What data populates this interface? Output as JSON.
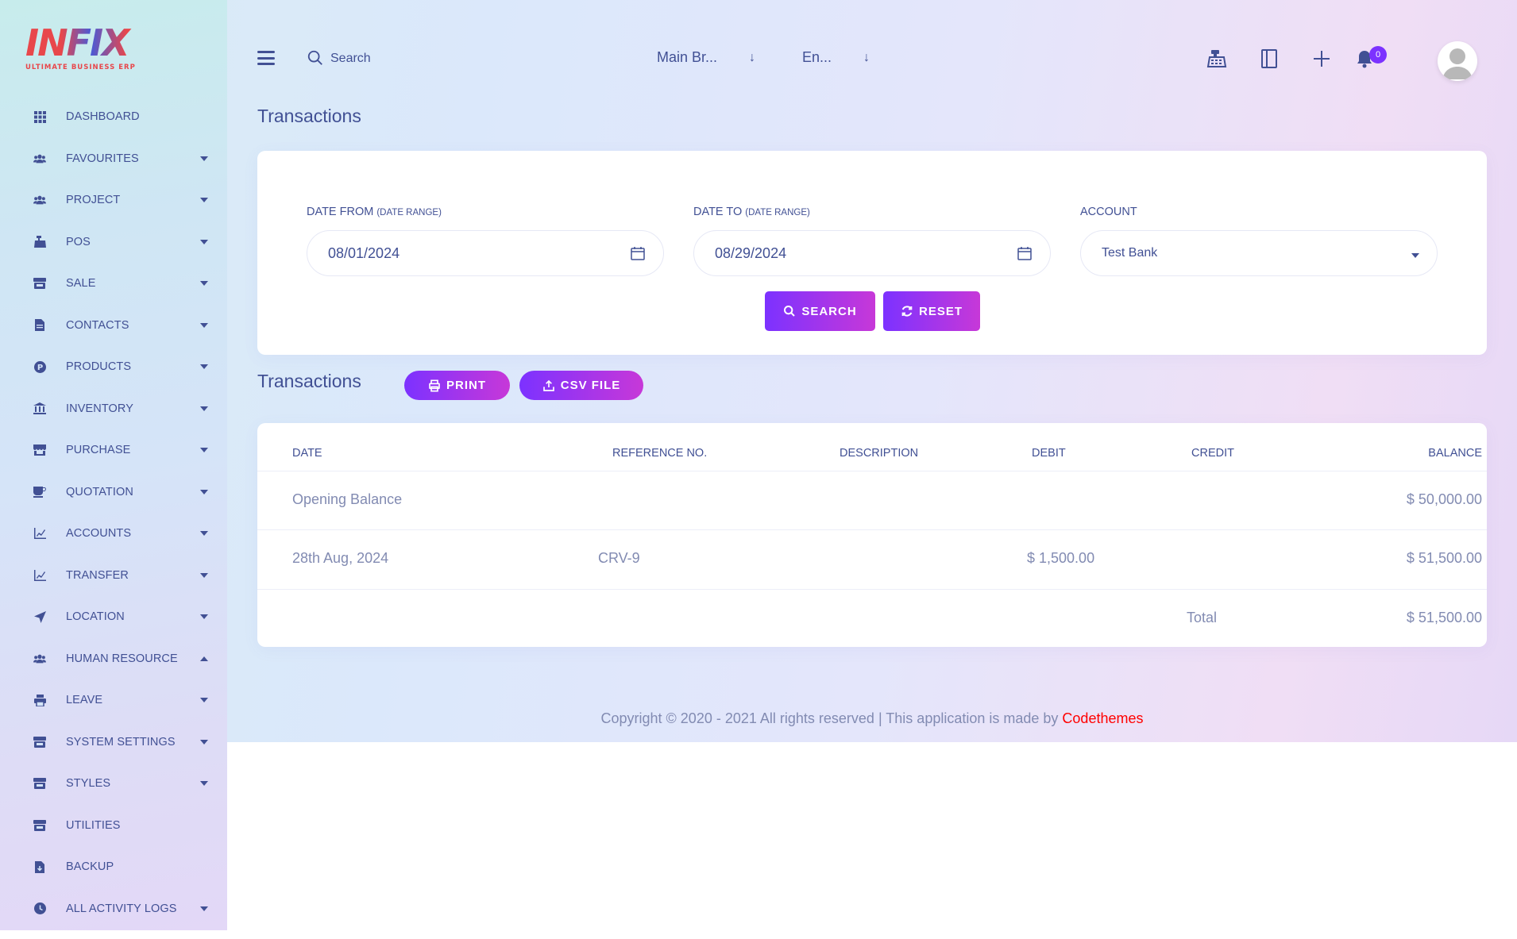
{
  "brand": {
    "logo_text": "INFIX",
    "tagline": "ULTIMATE BUSINESS ERP"
  },
  "sidebar": {
    "items": [
      {
        "label": "DASHBOARD",
        "icon": "grid-icon",
        "caret": ""
      },
      {
        "label": "FAVOURITES",
        "icon": "users-icon",
        "caret": "down"
      },
      {
        "label": "PROJECT",
        "icon": "users-icon",
        "caret": "down"
      },
      {
        "label": "POS",
        "icon": "cash-register-icon",
        "caret": "down"
      },
      {
        "label": "SALE",
        "icon": "store-icon",
        "caret": "down"
      },
      {
        "label": "CONTACTS",
        "icon": "file-icon",
        "caret": "down"
      },
      {
        "label": "PRODUCTS",
        "icon": "product-icon",
        "caret": "down"
      },
      {
        "label": "INVENTORY",
        "icon": "bank-icon",
        "caret": "down"
      },
      {
        "label": "PURCHASE",
        "icon": "shop-icon",
        "caret": "down"
      },
      {
        "label": "QUOTATION",
        "icon": "coffee-icon",
        "caret": "down"
      },
      {
        "label": "ACCOUNTS",
        "icon": "chart-icon",
        "caret": "down"
      },
      {
        "label": "TRANSFER",
        "icon": "chart-icon",
        "caret": "down"
      },
      {
        "label": "LOCATION",
        "icon": "location-arrow-icon",
        "caret": "down"
      },
      {
        "label": "HUMAN RESOURCE",
        "icon": "users-icon",
        "caret": "up"
      },
      {
        "label": "LEAVE",
        "icon": "print-icon",
        "caret": "down"
      },
      {
        "label": "SYSTEM SETTINGS",
        "icon": "store-icon",
        "caret": "down"
      },
      {
        "label": "STYLES",
        "icon": "store-icon",
        "caret": "down"
      },
      {
        "label": "UTILITIES",
        "icon": "store-icon",
        "caret": ""
      },
      {
        "label": "BACKUP",
        "icon": "file-download-icon",
        "caret": ""
      },
      {
        "label": "ALL ACTIVITY LOGS",
        "icon": "clock-icon",
        "caret": "down"
      }
    ]
  },
  "topbar": {
    "search_placeholder": "Search",
    "branch": "Main Br...",
    "language": "En...",
    "notifications_count": "0",
    "icons": [
      "cash-register-icon",
      "book-icon",
      "plus-icon",
      "bell-icon"
    ]
  },
  "page": {
    "title": "Transactions"
  },
  "filters": {
    "date_from_label": "DATE FROM",
    "date_from_hint": "(DATE RANGE)",
    "date_from_value": "08/01/2024",
    "date_to_label": "DATE TO",
    "date_to_hint": "(DATE RANGE)",
    "date_to_value": "08/29/2024",
    "account_label": "ACCOUNT",
    "account_value": "Test Bank",
    "search_button": "SEARCH",
    "reset_button": "RESET"
  },
  "transactions": {
    "title": "Transactions",
    "print_button": "PRINT",
    "csv_button": "CSV FILE",
    "columns": [
      "DATE",
      "REFERENCE NO.",
      "DESCRIPTION",
      "DEBIT",
      "CREDIT",
      "BALANCE"
    ],
    "rows": [
      {
        "date": "Opening Balance",
        "reference": "",
        "description": "",
        "debit": "",
        "credit": "",
        "balance": "$ 50,000.00"
      },
      {
        "date": "28th Aug, 2024",
        "reference": "CRV-9",
        "description": "",
        "debit": "$ 1,500.00",
        "credit": "",
        "balance": "$ 51,500.00"
      }
    ],
    "total_label": "Total",
    "total_value": "$ 51,500.00"
  },
  "footer": {
    "text": "Copyright © 2020 - 2021 All rights reserved | This application is made by",
    "link": "Codethemes"
  },
  "colors": {
    "primary_text": "#415094",
    "muted_text": "#828bb2",
    "accent_start": "#7c32ff",
    "accent_end": "#c738d8",
    "brand_red": "#e8474b",
    "link_red": "#ff0000"
  }
}
